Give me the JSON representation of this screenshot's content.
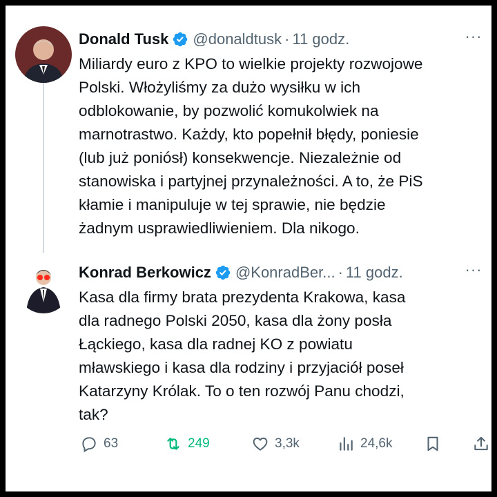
{
  "tweets": [
    {
      "name": "Donald Tusk",
      "handle": "@donaldtusk",
      "separator": "·",
      "time": "11 godz.",
      "lines": [
        "Miliardy euro z KPO to wielkie projekty rozwojowe",
        "Polski. Włożyliśmy za dużo wysiłku w ich",
        "odblokowanie, by pozwolić komukolwiek na",
        "marnotrastwo. Każdy, kto popełnił błędy, poniesie",
        "(lub już poniósł) konsekwencje. Niezależnie od",
        "stanowiska i partyjnej przynależności. A to, że PiS",
        "kłamie i manipuluje w tej sprawie, nie będzie",
        "żadnym usprawiedliwieniem. Dla nikogo."
      ]
    },
    {
      "name": "Konrad Berkowicz",
      "handle": "@KonradBer...",
      "separator": "·",
      "time": "11 godz.",
      "lines": [
        "Kasa dla firmy brata prezydenta Krakowa, kasa",
        "dla radnego Polski 2050, kasa dla żony posła",
        "Łąckiego, kasa dla radnej KO z powiatu",
        "mławskiego i kasa dla rodziny i przyjaciół poseł",
        "Katarzyny Królak. To o ten rozwój Panu chodzi,",
        "tak?"
      ]
    }
  ],
  "more_label": "···",
  "actions": {
    "replies": "63",
    "reposts": "249",
    "likes": "3,3k",
    "views": "24,6k"
  },
  "colors": {
    "verified": "#1d9bf0",
    "repost_active": "#00ba7c",
    "secondary_text": "#536471"
  },
  "icons": [
    "verified-badge-icon",
    "more-icon",
    "reply-icon",
    "repost-icon",
    "like-icon",
    "views-icon",
    "bookmark-icon",
    "share-icon"
  ]
}
